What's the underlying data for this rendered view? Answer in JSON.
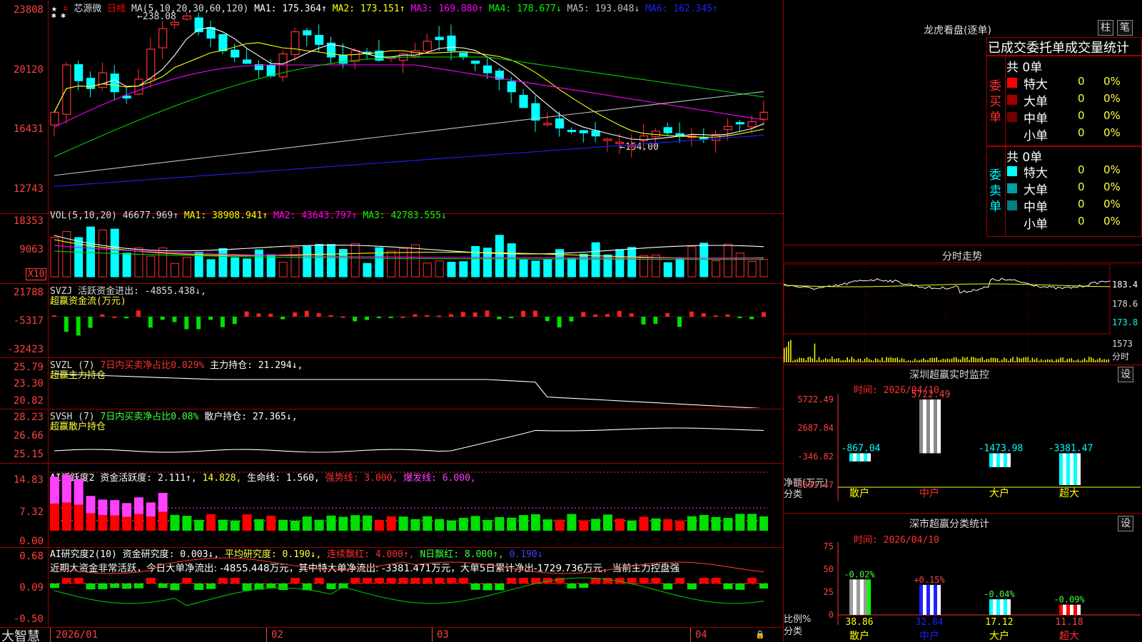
{
  "stock": {
    "name": "芯源微",
    "period": "日线"
  },
  "ma_header": {
    "prefix": "MA(5,10,20,30,60,120)",
    "items": [
      {
        "label": "MA1: 175.364↑",
        "color": "#ffffff"
      },
      {
        "label": "MA2: 173.151↑",
        "color": "#ffff00"
      },
      {
        "label": "MA3: 169.880↑",
        "color": "#ff00ff"
      },
      {
        "label": "MA4: 178.677↓",
        "color": "#00ff00"
      },
      {
        "label": "MA5: 193.048↓",
        "color": "#c0c0c0"
      },
      {
        "label": "MA6: 162.345↑",
        "color": "#2020ff"
      }
    ]
  },
  "price_axis": [
    "23808",
    "20120",
    "16431",
    "12743"
  ],
  "price_annotations": {
    "high": "238.08",
    "low": "154.00"
  },
  "vol": {
    "prefix": "VOL(5,10,20)",
    "value": "46677.969↑",
    "ma": [
      {
        "label": "MA1: 38908.941↑",
        "color": "#ffff00"
      },
      {
        "label": "MA2: 43643.797↑",
        "color": "#ff00ff"
      },
      {
        "label": "MA3: 42783.555↓",
        "color": "#00ff00"
      }
    ],
    "axis": [
      "18353",
      "9063"
    ],
    "unit": "X10"
  },
  "svzj": {
    "line1": "SVZJ  活跃资金进出: -4855.438↓,",
    "line2": "超赢资金流(万元)",
    "axis": [
      "21788",
      "-5317",
      "-32423"
    ]
  },
  "svzl": {
    "prefix": "SVZL (7)",
    "pct": "7日内买卖净占比0.029%",
    "hold": "主力持仓: 21.294↓,",
    "sub": "超赢主力持仓",
    "axis": [
      "25.79",
      "23.30",
      "20.82"
    ]
  },
  "svsh": {
    "prefix": "SVSH (7)",
    "pct": "7日内买卖净占比0.08%",
    "hold": "散户持仓: 27.365↓,",
    "sub": "超赢散户持仓",
    "axis": [
      "28.23",
      "26.66",
      "25.15"
    ]
  },
  "ai_active": {
    "prefix": "AI活跃度2 资金活跃度: 2.111↑,",
    "v1": "14.828,",
    "v2": "生命线: 1.560,",
    "v3": "强势线: 3.000,",
    "v4": "爆发线: 6.000,",
    "axis": [
      "14.83",
      "7.32",
      "0.00"
    ]
  },
  "ai_research": {
    "prefix": "AI研究度2(10) 资金研究度: 0.003↓,",
    "avg": "平均研究度: 0.190↓,",
    "streak": "连续飘红: 4.000↑,",
    "nday": "N日飘红: 8.000↑,",
    "last": "0.190↓",
    "comment": "近期大资金非常活跃，今日大单净流出: -4855.448万元，其中特大单净流出: -3381.471万元，大单5日累计净出-1729.736万元，当前主力控盘强",
    "axis": [
      "0.68",
      "0.09",
      "-0.50"
    ]
  },
  "x_axis": [
    "2026/01",
    "02",
    "03",
    "04"
  ],
  "brand": "大智慧",
  "lhb": {
    "title": "龙虎看盘(逐单)",
    "btn1": "柱",
    "btn2": "笔",
    "header": "已成交委托单成交量统计",
    "buy": {
      "group": "委买单",
      "total": "共 0单",
      "rows": [
        {
          "name": "特大",
          "count": "0",
          "pct": "0%",
          "color": "#ff0000"
        },
        {
          "name": "大单",
          "count": "0",
          "pct": "0%",
          "color": "#a00000"
        },
        {
          "name": "中单",
          "count": "0",
          "pct": "0%",
          "color": "#700000"
        },
        {
          "name": "小单",
          "count": "0",
          "pct": "0%",
          "color": "#000000"
        }
      ]
    },
    "sell": {
      "group": "委卖单",
      "total": "共 0单",
      "rows": [
        {
          "name": "特大",
          "count": "0",
          "pct": "0%",
          "color": "#00ffff"
        },
        {
          "name": "大单",
          "count": "0",
          "pct": "0%",
          "color": "#00a0a0"
        },
        {
          "name": "中单",
          "count": "0",
          "pct": "0%",
          "color": "#008080"
        },
        {
          "name": "小单",
          "count": "0",
          "pct": "0%",
          "color": "#000000"
        }
      ]
    }
  },
  "fenshi": {
    "title": "分时走势",
    "axis": [
      "183.4",
      "178.6",
      "173.8"
    ],
    "vol_axis": "1573",
    "vol_label": "分时"
  },
  "monitor": {
    "title": "深圳超赢实时监控",
    "btn": "设",
    "time": "时间: 2026/04/10",
    "axis": [
      "5722.49",
      "2687.84",
      "-346.82",
      "-3381.47"
    ],
    "side1": "净额(万元)",
    "side2": "分类",
    "bars": [
      {
        "name": "散户",
        "value": -867.04,
        "label": "-867.04"
      },
      {
        "name": "中户",
        "value": 5722.49,
        "label": "5722.49"
      },
      {
        "name": "大户",
        "value": -1473.98,
        "label": "-1473.98"
      },
      {
        "name": "超大",
        "value": -3381.47,
        "label": "-3381.47"
      }
    ]
  },
  "classify": {
    "title": "深市超赢分类统计",
    "btn": "设",
    "time": "时间: 2026/04/10",
    "axis": [
      "75",
      "50",
      "25",
      "0"
    ],
    "side1": "比例%",
    "side2": "分类",
    "bars": [
      {
        "name": "散户",
        "value": 38.86,
        "change": "-0.02%",
        "color": "#ffffff",
        "vcolor": "#ffff00"
      },
      {
        "name": "中户",
        "value": 32.84,
        "change": "+0.15%",
        "color": "#2020ff",
        "vcolor": "#2020ff"
      },
      {
        "name": "大户",
        "value": 17.12,
        "change": "-0.04%",
        "color": "#00ffff",
        "vcolor": "#ffff00"
      },
      {
        "name": "超大",
        "value": 11.18,
        "change": "-0.09%",
        "color": "#ff0000",
        "vcolor": "#ff4040"
      }
    ]
  },
  "chart_data": {
    "type": "bar",
    "title": "深圳超赢实时监控",
    "categories": [
      "散户",
      "中户",
      "大户",
      "超大"
    ],
    "values": [
      -867.04,
      5722.49,
      -1473.98,
      -3381.47
    ],
    "ylabel": "净额(万元)",
    "ylim": [
      -3381.47,
      5722.49
    ]
  }
}
